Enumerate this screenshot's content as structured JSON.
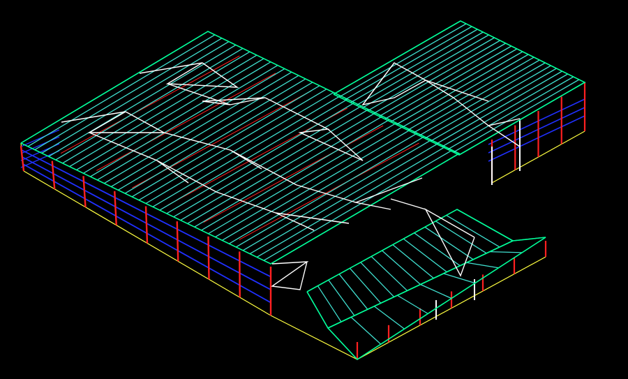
{
  "view": {
    "background": "#000000",
    "description_visible_text": ""
  },
  "palette": {
    "roof_purlin": "#40e0d0",
    "roof_edge": "#00ff99",
    "bracing": "#ffffff",
    "column": "#ff2020",
    "girt": "#2030ff",
    "base_outline": "#ffff40",
    "ridge": "#c8c850"
  },
  "layers": [
    {
      "name": "roof-purlins",
      "color_key": "roof_purlin"
    },
    {
      "name": "roof-bracing",
      "color_key": "bracing"
    },
    {
      "name": "columns",
      "color_key": "column"
    },
    {
      "name": "wall-girts",
      "color_key": "girt"
    },
    {
      "name": "base-outline",
      "color_key": "base_outline"
    }
  ]
}
